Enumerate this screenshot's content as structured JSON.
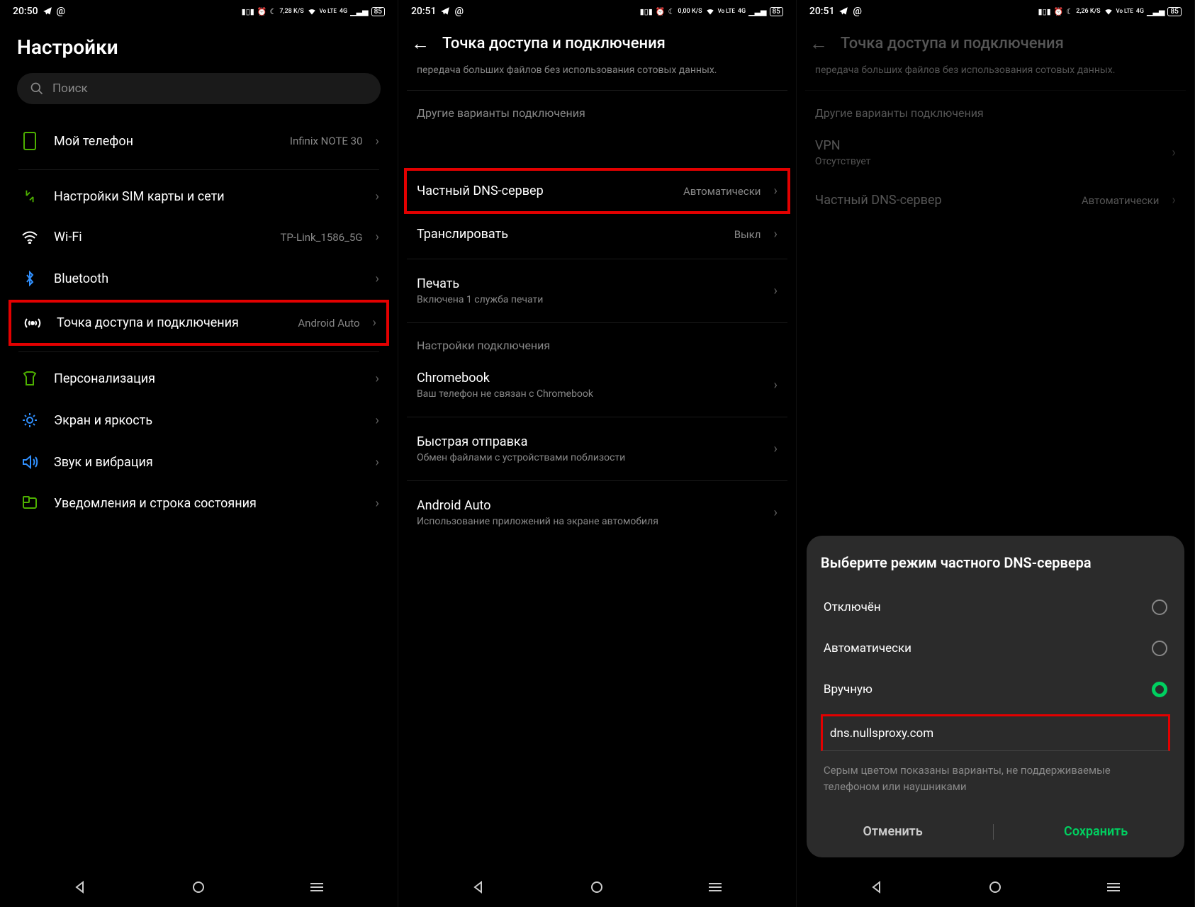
{
  "screens": [
    {
      "status": {
        "time": "20:50",
        "net_speed": "7,28 K/S",
        "battery": "85"
      },
      "title": "Настройки",
      "search_placeholder": "Поиск",
      "rows": [
        {
          "label": "Мой телефон",
          "value": "Infinix NOTE 30"
        },
        {
          "label": "Настройки SIM карты и сети"
        },
        {
          "label": "Wi-Fi",
          "value": "TP-Link_1586_5G"
        },
        {
          "label": "Bluetooth"
        },
        {
          "label": "Точка доступа и подключения",
          "value": "Android Auto"
        },
        {
          "label": "Персонализация"
        },
        {
          "label": "Экран и яркость"
        },
        {
          "label": "Звук и вибрация"
        },
        {
          "label": "Уведомления и строка состояния"
        }
      ]
    },
    {
      "status": {
        "time": "20:51",
        "net_speed": "0,00 K/S",
        "battery": "85"
      },
      "title": "Точка доступа и подключения",
      "truncated_text": "передача больших файлов без использования сотовых данных.",
      "section1": "Другие варианты подключения",
      "rows": [
        {
          "label": "Частный DNS-сервер",
          "value": "Автоматически"
        },
        {
          "label": "Транслировать",
          "value": "Выкл"
        },
        {
          "label": "Печать",
          "sub": "Включена 1 служба печати"
        }
      ],
      "section2": "Настройки подключения",
      "rows2": [
        {
          "label": "Chromebook",
          "sub": "Ваш телефон не связан с Chromebook"
        },
        {
          "label": "Быстрая отправка",
          "sub": "Обмен файлами с устройствами поблизости"
        },
        {
          "label": "Android Auto",
          "sub": "Использование приложений на экране автомобиля"
        }
      ]
    },
    {
      "status": {
        "time": "20:51",
        "net_speed": "2,26 K/S",
        "battery": "85"
      },
      "title": "Точка доступа и подключения",
      "truncated_text": "передача больших файлов без использования сотовых данных.",
      "section1": "Другие варианты подключения",
      "vpn": {
        "label": "VPN",
        "sub": "Отсутствует"
      },
      "dns": {
        "label": "Частный DNS-сервер",
        "value": "Автоматически"
      },
      "sheet": {
        "title": "Выберите режим частного DNS-сервера",
        "options": [
          {
            "label": "Отключён",
            "selected": false
          },
          {
            "label": "Автоматически",
            "selected": false
          },
          {
            "label": "Вручную",
            "selected": true
          }
        ],
        "input_value": "dns.nullsproxy.com",
        "hint": "Серым цветом показаны варианты, не поддерживаемые телефоном или наушниками",
        "cancel": "Отменить",
        "save": "Сохранить"
      }
    }
  ],
  "icon_labels": {
    "vo_lte": "Vo LTE",
    "4g": "4G"
  }
}
